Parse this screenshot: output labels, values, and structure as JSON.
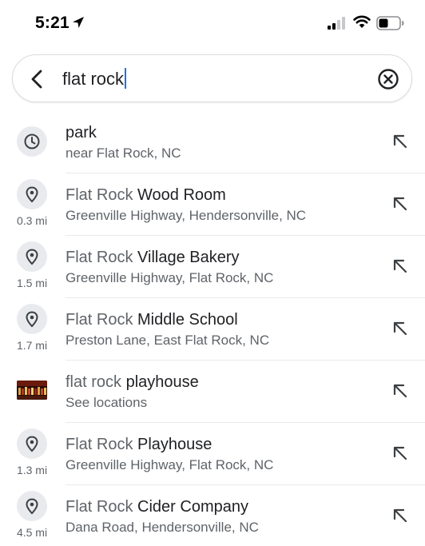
{
  "status_bar": {
    "time": "5:21"
  },
  "search": {
    "query": "flat rock"
  },
  "results": [
    {
      "kind": "history",
      "title_match": "",
      "title_rest": "park",
      "subtitle": "near Flat Rock, NC",
      "distance": ""
    },
    {
      "kind": "place",
      "title_match": "Flat Rock",
      "title_rest": " Wood Room",
      "subtitle": "Greenville Highway, Hendersonville, NC",
      "distance": "0.3 mi"
    },
    {
      "kind": "place",
      "title_match": "Flat Rock",
      "title_rest": " Village Bakery",
      "subtitle": "Greenville Highway, Flat Rock, NC",
      "distance": "1.5 mi"
    },
    {
      "kind": "place",
      "title_match": "Flat Rock",
      "title_rest": " Middle School",
      "subtitle": "Preston Lane, East Flat Rock, NC",
      "distance": "1.7 mi"
    },
    {
      "kind": "image",
      "title_match": "flat rock",
      "title_rest": " playhouse",
      "subtitle": "See locations",
      "distance": ""
    },
    {
      "kind": "place",
      "title_match": "Flat Rock",
      "title_rest": " Playhouse",
      "subtitle": "Greenville Highway, Flat Rock, NC",
      "distance": "1.3 mi"
    },
    {
      "kind": "place",
      "title_match": "Flat Rock",
      "title_rest": " Cider Company",
      "subtitle": "Dana Road, Hendersonville, NC",
      "distance": "4.5 mi"
    }
  ],
  "icons": {
    "history": "clock-icon",
    "place": "location-pin-icon",
    "fill": "fill-query-arrow-icon",
    "back": "back-chevron-icon",
    "clear": "clear-circle-x-icon"
  },
  "colors": {
    "accent": "#1a73e8",
    "text_primary": "#202124",
    "text_secondary": "#5f6368",
    "icon_bg": "#e8eaed"
  }
}
